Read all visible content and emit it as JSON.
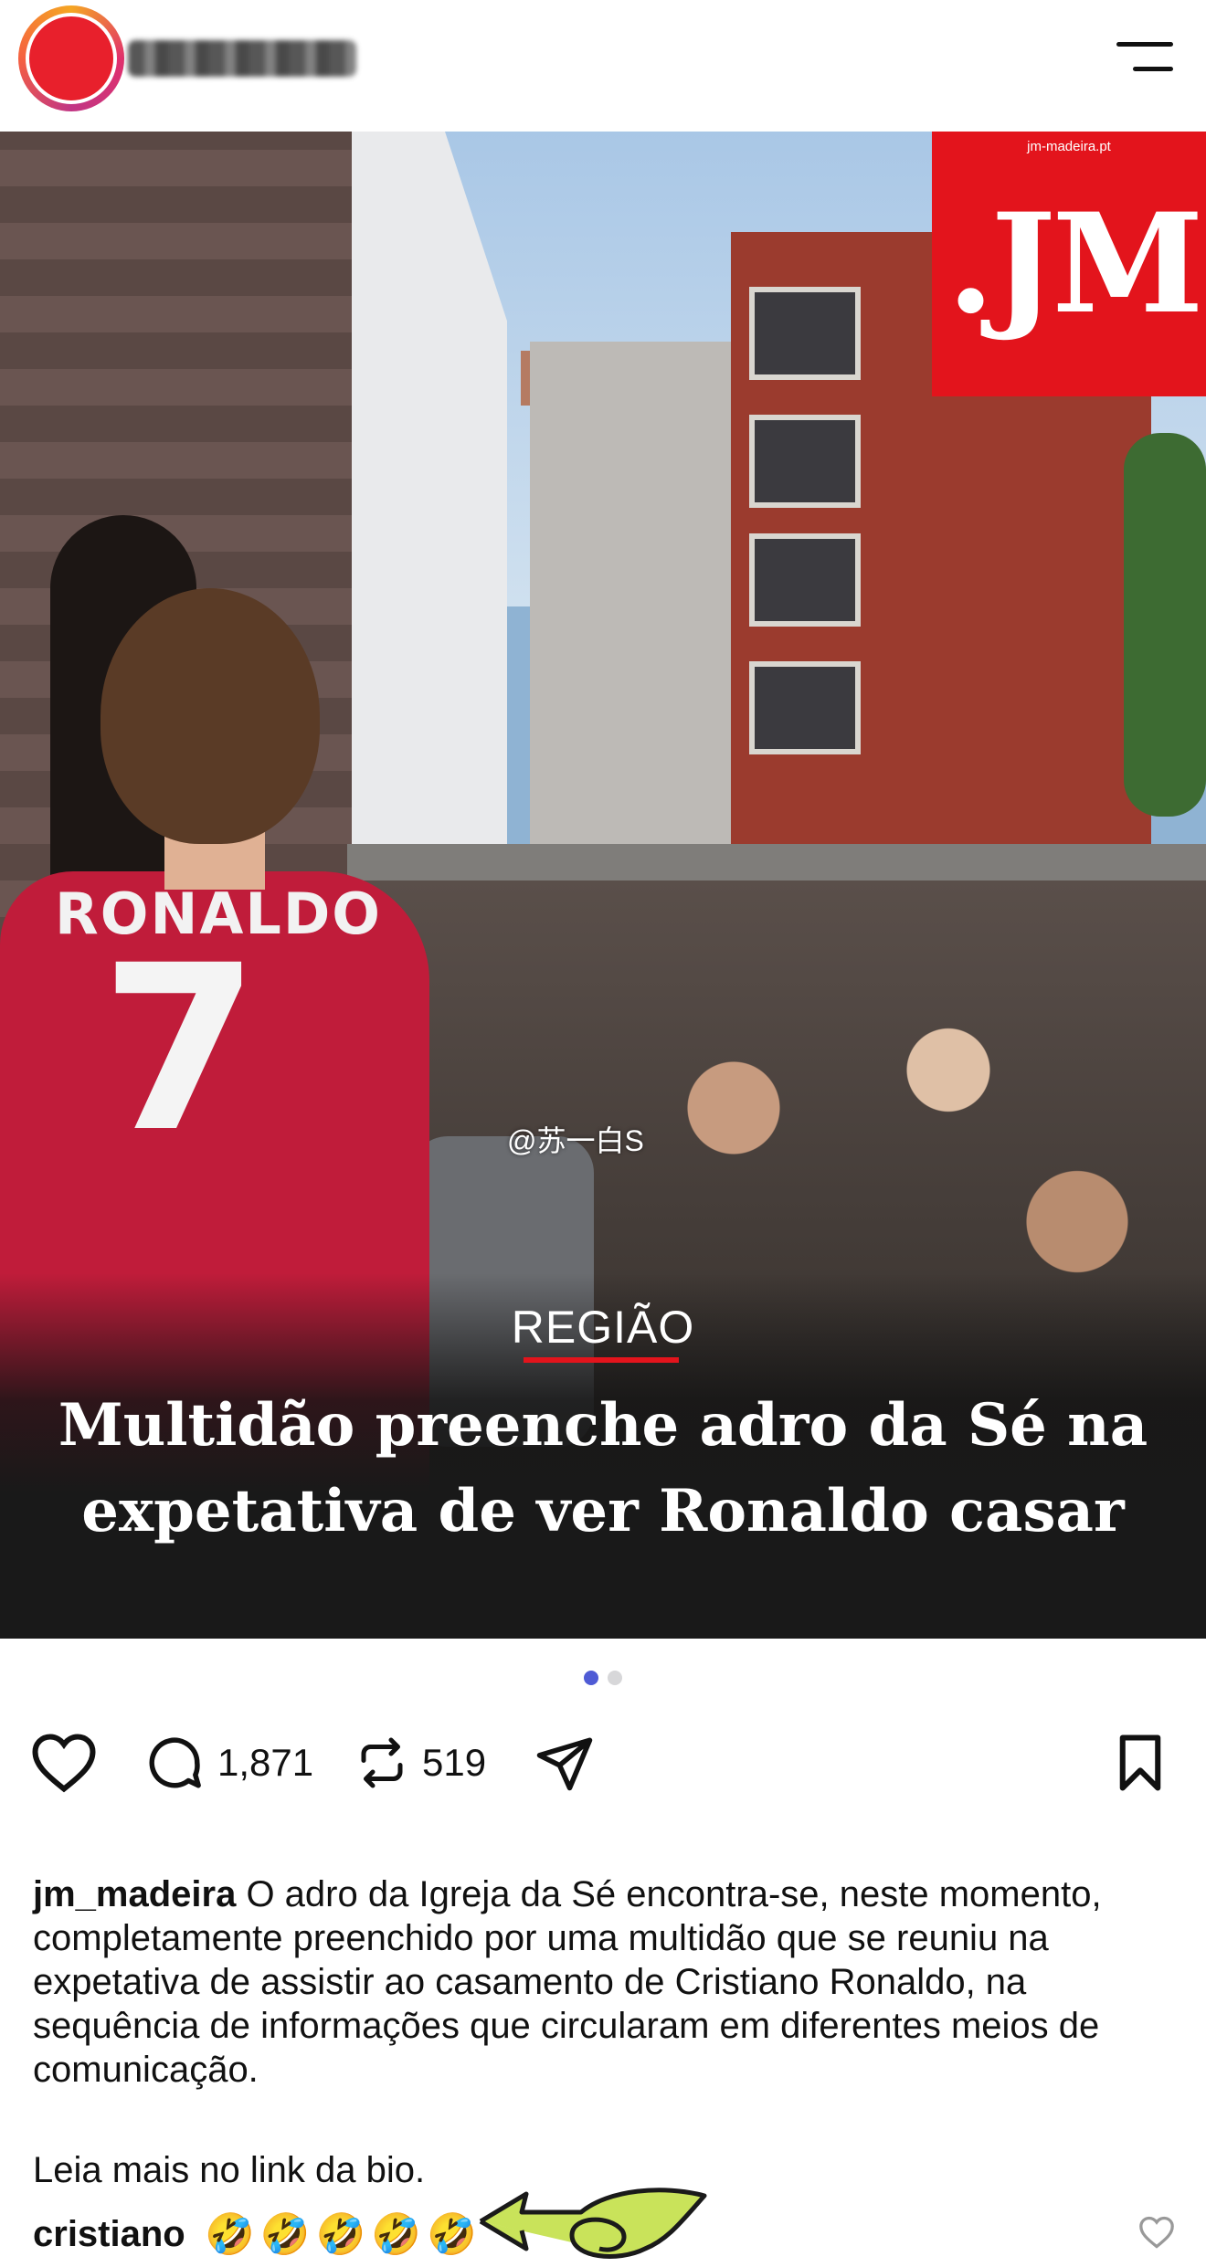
{
  "header": {
    "username": "",
    "menu": "menu"
  },
  "post": {
    "logo_url": "jm-madeira.pt",
    "logo_text": ".JM",
    "shirt_name": "RONALDO",
    "shirt_number": "7",
    "watermark": "@苏一白S",
    "section": "REGIÃO",
    "headline": "Multidão preenche adro da Sé na expetativa de ver Ronaldo casar"
  },
  "pagination": {
    "current": 1,
    "total": 2
  },
  "actions": {
    "comments_count": "1,871",
    "reposts_count": "519"
  },
  "caption": {
    "user": "jm_madeira",
    "text": " O adro da Igreja da Sé encontra-se, neste momento, completamente preenchido por uma multidão que se reuniu na expetativa de assistir ao casamento de Cristiano Ronaldo, na sequência de informações que circularam em diferentes meios de comunicação.",
    "more": "Leia mais no link da bio."
  },
  "top_comment": {
    "user": "cristiano",
    "emojis": "🤣🤣🤣🤣🤣"
  },
  "colors": {
    "accent": "#4f5bd5",
    "brand_red": "#e3141c"
  }
}
